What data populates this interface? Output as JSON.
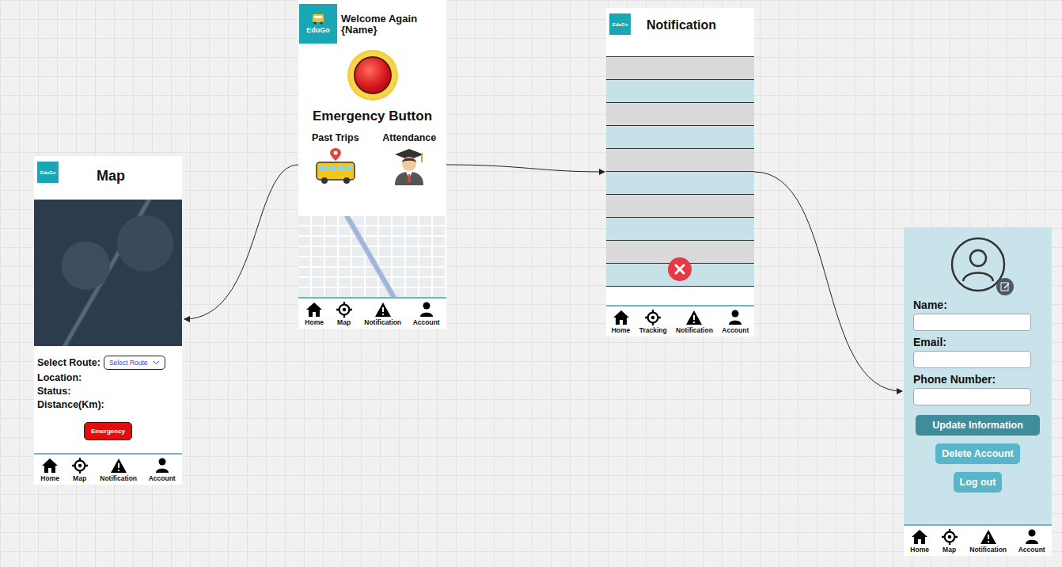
{
  "logo": "EduGo",
  "home_screen": {
    "welcome": "Welcome Again {Name}",
    "emergency_label": "Emergency Button",
    "tiles": [
      {
        "label": "Past Trips"
      },
      {
        "label": "Attendance"
      }
    ],
    "nav": [
      "Home",
      "Map",
      "Notification",
      "Account"
    ]
  },
  "map_screen": {
    "title": "Map",
    "select_label": "Select Route:",
    "select_value": "Select Route",
    "fields": [
      "Location:",
      "Status:",
      "Distance(Km):"
    ],
    "button": "Emergency",
    "nav": [
      "Home",
      "Map",
      "Notification",
      "Account"
    ]
  },
  "notification_screen": {
    "title": "Notification",
    "rows": [
      {
        "color": "#d9d9d9"
      },
      {
        "color": "#c6e1e7"
      },
      {
        "color": "#d9d9d9"
      },
      {
        "color": "#c6e1e7"
      },
      {
        "color": "#d9d9d9"
      },
      {
        "color": "#c6e1e7"
      },
      {
        "color": "#d9d9d9"
      },
      {
        "color": "#c6e1e7"
      },
      {
        "color": "#d9d9d9"
      },
      {
        "color": "#c6e1e7"
      }
    ],
    "nav": [
      "Home",
      "Tracking",
      "Notification",
      "Account"
    ]
  },
  "account_screen": {
    "fields": [
      "Name:",
      "Email:",
      "Phone Number:"
    ],
    "buttons": [
      {
        "label": "Update Information",
        "color": "#3f8c9a"
      },
      {
        "label": "Delete Account",
        "color": "#58b6c8"
      },
      {
        "label": "Log out",
        "color": "#58b6c8"
      }
    ],
    "nav": [
      "Home",
      "Map",
      "Notification",
      "Account"
    ]
  }
}
